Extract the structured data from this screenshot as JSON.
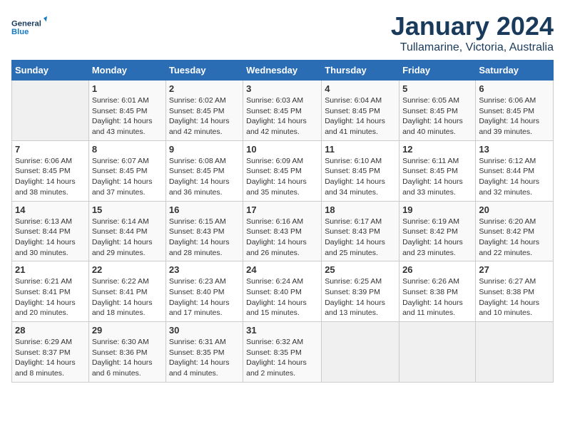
{
  "logo": {
    "general": "General",
    "blue": "Blue"
  },
  "header": {
    "month": "January 2024",
    "location": "Tullamarine, Victoria, Australia"
  },
  "weekdays": [
    "Sunday",
    "Monday",
    "Tuesday",
    "Wednesday",
    "Thursday",
    "Friday",
    "Saturday"
  ],
  "weeks": [
    [
      {
        "day": "",
        "sunrise": "",
        "sunset": "",
        "daylight": ""
      },
      {
        "day": "1",
        "sunrise": "6:01 AM",
        "sunset": "8:45 PM",
        "daylight": "14 hours and 43 minutes."
      },
      {
        "day": "2",
        "sunrise": "6:02 AM",
        "sunset": "8:45 PM",
        "daylight": "14 hours and 42 minutes."
      },
      {
        "day": "3",
        "sunrise": "6:03 AM",
        "sunset": "8:45 PM",
        "daylight": "14 hours and 42 minutes."
      },
      {
        "day": "4",
        "sunrise": "6:04 AM",
        "sunset": "8:45 PM",
        "daylight": "14 hours and 41 minutes."
      },
      {
        "day": "5",
        "sunrise": "6:05 AM",
        "sunset": "8:45 PM",
        "daylight": "14 hours and 40 minutes."
      },
      {
        "day": "6",
        "sunrise": "6:06 AM",
        "sunset": "8:45 PM",
        "daylight": "14 hours and 39 minutes."
      }
    ],
    [
      {
        "day": "7",
        "sunrise": "6:06 AM",
        "sunset": "8:45 PM",
        "daylight": "14 hours and 38 minutes."
      },
      {
        "day": "8",
        "sunrise": "6:07 AM",
        "sunset": "8:45 PM",
        "daylight": "14 hours and 37 minutes."
      },
      {
        "day": "9",
        "sunrise": "6:08 AM",
        "sunset": "8:45 PM",
        "daylight": "14 hours and 36 minutes."
      },
      {
        "day": "10",
        "sunrise": "6:09 AM",
        "sunset": "8:45 PM",
        "daylight": "14 hours and 35 minutes."
      },
      {
        "day": "11",
        "sunrise": "6:10 AM",
        "sunset": "8:45 PM",
        "daylight": "14 hours and 34 minutes."
      },
      {
        "day": "12",
        "sunrise": "6:11 AM",
        "sunset": "8:45 PM",
        "daylight": "14 hours and 33 minutes."
      },
      {
        "day": "13",
        "sunrise": "6:12 AM",
        "sunset": "8:44 PM",
        "daylight": "14 hours and 32 minutes."
      }
    ],
    [
      {
        "day": "14",
        "sunrise": "6:13 AM",
        "sunset": "8:44 PM",
        "daylight": "14 hours and 30 minutes."
      },
      {
        "day": "15",
        "sunrise": "6:14 AM",
        "sunset": "8:44 PM",
        "daylight": "14 hours and 29 minutes."
      },
      {
        "day": "16",
        "sunrise": "6:15 AM",
        "sunset": "8:43 PM",
        "daylight": "14 hours and 28 minutes."
      },
      {
        "day": "17",
        "sunrise": "6:16 AM",
        "sunset": "8:43 PM",
        "daylight": "14 hours and 26 minutes."
      },
      {
        "day": "18",
        "sunrise": "6:17 AM",
        "sunset": "8:43 PM",
        "daylight": "14 hours and 25 minutes."
      },
      {
        "day": "19",
        "sunrise": "6:19 AM",
        "sunset": "8:42 PM",
        "daylight": "14 hours and 23 minutes."
      },
      {
        "day": "20",
        "sunrise": "6:20 AM",
        "sunset": "8:42 PM",
        "daylight": "14 hours and 22 minutes."
      }
    ],
    [
      {
        "day": "21",
        "sunrise": "6:21 AM",
        "sunset": "8:41 PM",
        "daylight": "14 hours and 20 minutes."
      },
      {
        "day": "22",
        "sunrise": "6:22 AM",
        "sunset": "8:41 PM",
        "daylight": "14 hours and 18 minutes."
      },
      {
        "day": "23",
        "sunrise": "6:23 AM",
        "sunset": "8:40 PM",
        "daylight": "14 hours and 17 minutes."
      },
      {
        "day": "24",
        "sunrise": "6:24 AM",
        "sunset": "8:40 PM",
        "daylight": "14 hours and 15 minutes."
      },
      {
        "day": "25",
        "sunrise": "6:25 AM",
        "sunset": "8:39 PM",
        "daylight": "14 hours and 13 minutes."
      },
      {
        "day": "26",
        "sunrise": "6:26 AM",
        "sunset": "8:38 PM",
        "daylight": "14 hours and 11 minutes."
      },
      {
        "day": "27",
        "sunrise": "6:27 AM",
        "sunset": "8:38 PM",
        "daylight": "14 hours and 10 minutes."
      }
    ],
    [
      {
        "day": "28",
        "sunrise": "6:29 AM",
        "sunset": "8:37 PM",
        "daylight": "14 hours and 8 minutes."
      },
      {
        "day": "29",
        "sunrise": "6:30 AM",
        "sunset": "8:36 PM",
        "daylight": "14 hours and 6 minutes."
      },
      {
        "day": "30",
        "sunrise": "6:31 AM",
        "sunset": "8:35 PM",
        "daylight": "14 hours and 4 minutes."
      },
      {
        "day": "31",
        "sunrise": "6:32 AM",
        "sunset": "8:35 PM",
        "daylight": "14 hours and 2 minutes."
      },
      {
        "day": "",
        "sunrise": "",
        "sunset": "",
        "daylight": ""
      },
      {
        "day": "",
        "sunrise": "",
        "sunset": "",
        "daylight": ""
      },
      {
        "day": "",
        "sunrise": "",
        "sunset": "",
        "daylight": ""
      }
    ]
  ]
}
